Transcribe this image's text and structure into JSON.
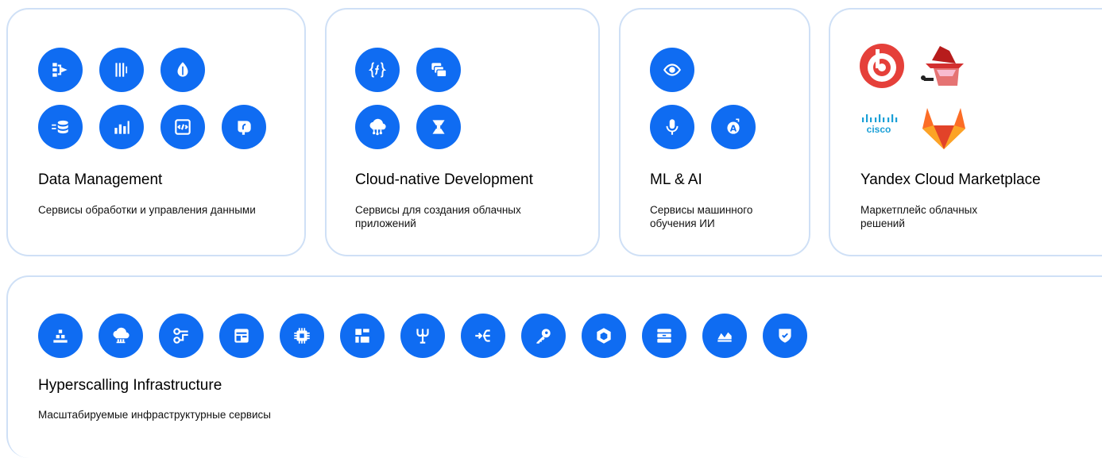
{
  "cards": {
    "data_management": {
      "title": "Data Management",
      "description": "Сервисы обработки и управления данными",
      "icons": [
        "data-transfer-icon",
        "streams-icon",
        "leaf-db-icon",
        "database-stack-icon",
        "bar-chart-icon",
        "code-window-icon",
        "elephant-icon"
      ]
    },
    "cloud_native": {
      "title": "Cloud-native Development",
      "description": "Сервисы для создания облачных приложений",
      "icons": [
        "function-braces-icon",
        "stacked-windows-icon",
        "cloud-network-icon",
        "hourglass-icon"
      ]
    },
    "ml_ai": {
      "title": "ML & AI",
      "description": "Сервисы машинного обучения ИИ",
      "icons": [
        "eye-icon",
        "microphone-icon",
        "translate-icon"
      ]
    },
    "marketplace": {
      "title": "Yandex Cloud Marketplace",
      "description": "Маркетплейс облачных решений",
      "logos": [
        "bitrix-logo",
        "detective-logo",
        "cisco-logo",
        "gitlab-logo"
      ],
      "cisco_text": "cisco"
    },
    "infrastructure": {
      "title": "Hyperscalling Infrastructure",
      "description": "Масштабируемые инфраструктурные сервисы",
      "icons": [
        "container-registry-icon",
        "cloud-cdn-icon",
        "network-nodes-icon",
        "instance-group-icon",
        "chip-icon",
        "load-blocks-icon",
        "api-gateway-icon",
        "split-arrow-icon",
        "key-icon",
        "hexagon-icon",
        "storage-drawer-icon",
        "monitoring-icon",
        "shield-check-icon"
      ]
    }
  },
  "colors": {
    "accent": "#0f6cf2",
    "border": "#cfe0f6"
  }
}
